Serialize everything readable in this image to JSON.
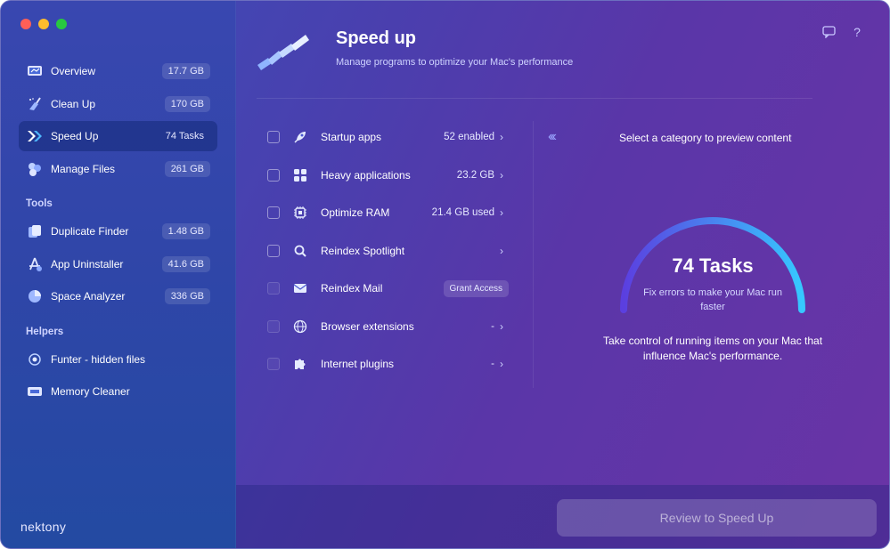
{
  "sidebar": {
    "items": [
      {
        "label": "Overview",
        "badge": "17.7 GB"
      },
      {
        "label": "Clean Up",
        "badge": "170 GB"
      },
      {
        "label": "Speed Up",
        "badge": "74 Tasks"
      },
      {
        "label": "Manage Files",
        "badge": "261 GB"
      }
    ],
    "tools_label": "Tools",
    "tools": [
      {
        "label": "Duplicate Finder",
        "badge": "1.48 GB"
      },
      {
        "label": "App Uninstaller",
        "badge": "41.6 GB"
      },
      {
        "label": "Space Analyzer",
        "badge": "336 GB"
      }
    ],
    "helpers_label": "Helpers",
    "helpers": [
      {
        "label": "Funter - hidden files"
      },
      {
        "label": "Memory Cleaner"
      }
    ],
    "brand": "nektony"
  },
  "header": {
    "title": "Speed up",
    "subtitle": "Manage programs to optimize your Mac's performance"
  },
  "list": [
    {
      "label": "Startup apps",
      "value": "52 enabled"
    },
    {
      "label": "Heavy applications",
      "value": "23.2 GB"
    },
    {
      "label": "Optimize RAM",
      "value": "21.4 GB used"
    },
    {
      "label": "Reindex Spotlight",
      "value": ""
    },
    {
      "label": "Reindex Mail",
      "value": "Grant Access"
    },
    {
      "label": "Browser extensions",
      "value": "-"
    },
    {
      "label": "Internet plugins",
      "value": "-"
    }
  ],
  "preview": {
    "hint": "Select a category to preview content",
    "gauge_title": "74 Tasks",
    "gauge_sub": "Fix errors to make your Mac run faster",
    "description": "Take control of running items on your Mac that influence Mac's performance."
  },
  "footer": {
    "review_label": "Review to Speed Up"
  },
  "colors": {
    "accent_gradient_start": "#5b3fe0",
    "accent_gradient_end": "#36c8ff"
  }
}
